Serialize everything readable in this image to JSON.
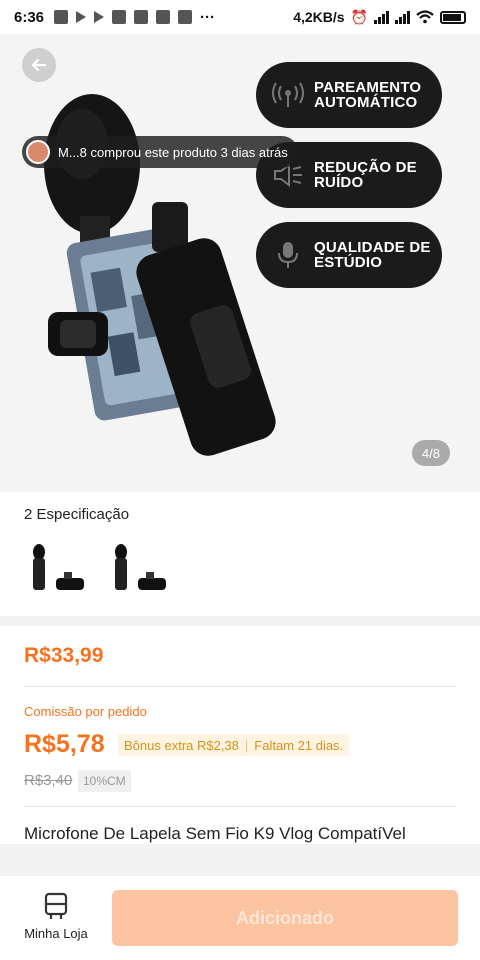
{
  "status_bar": {
    "time": "6:36",
    "net_speed": "4,2KB/s"
  },
  "gallery": {
    "features": [
      {
        "label": "PAREAMENTO AUTOMÁTICO",
        "icon": "signal-icon"
      },
      {
        "label": "REDUÇÃO DE RUÍDO",
        "icon": "speaker-mute-icon"
      },
      {
        "label": "QUALIDADE DE ESTÚDIO",
        "icon": "microphone-icon"
      }
    ],
    "buyer_notice": "M...8 comprou este produto 3 dias atrás",
    "counter": "4/8"
  },
  "specs": {
    "title": "2 Especificação"
  },
  "pricing": {
    "price": "R$33,99",
    "commission_label": "Comissão por pedido",
    "commission_value": "R$5,78",
    "bonus": "Bônus extra R$2,38",
    "bonus_deadline": "Faltam 21 dias.",
    "old_commission": "R$3,40",
    "commission_rate": "10%CM"
  },
  "product": {
    "title": "Microfone De Lapela Sem Fio K9 Vlog CompatíVel"
  },
  "bottom_bar": {
    "store_label": "Minha Loja",
    "add_button": "Adicionado"
  },
  "colors": {
    "accent": "#f5731f",
    "button_disabled": "#fcc3a0",
    "bonus_bg": "#fff4e2",
    "feature_pill": "#1b1b1b"
  }
}
